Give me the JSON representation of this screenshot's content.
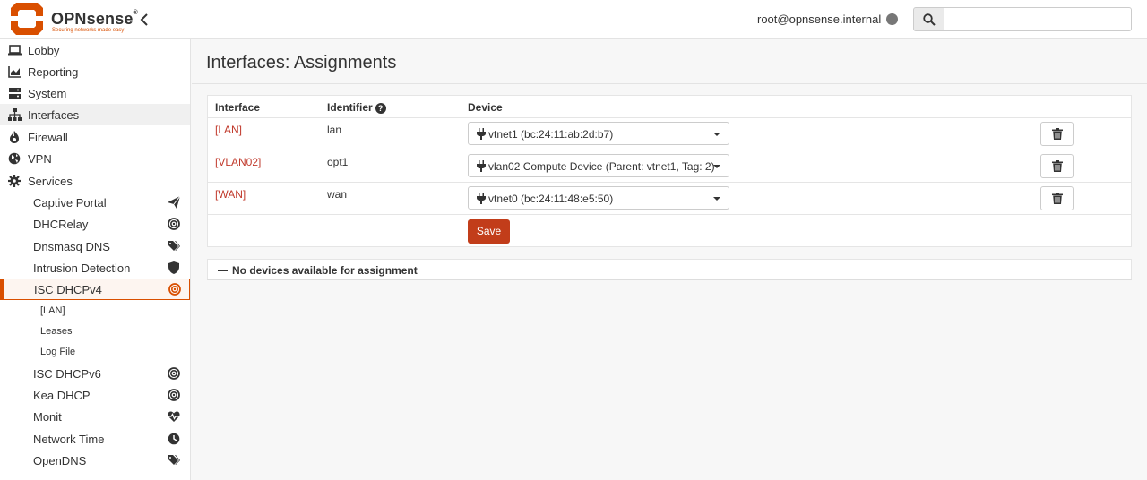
{
  "header": {
    "logo_name": "OPNsense",
    "logo_reg": "®",
    "tagline": "Securing networks made easy",
    "user": "root@opnsense.internal",
    "search_placeholder": "",
    "accent_color": "#d94f00"
  },
  "sidebar": {
    "items": [
      {
        "label": "Lobby",
        "icon": "laptop-icon"
      },
      {
        "label": "Reporting",
        "icon": "chart-icon"
      },
      {
        "label": "System",
        "icon": "server-icon"
      },
      {
        "label": "Interfaces",
        "icon": "sitemap-icon"
      },
      {
        "label": "Firewall",
        "icon": "fire-icon"
      },
      {
        "label": "VPN",
        "icon": "globe-icon"
      },
      {
        "label": "Services",
        "icon": "gear-icon"
      }
    ],
    "services": [
      {
        "label": "Captive Portal",
        "icon": "paper-plane-icon"
      },
      {
        "label": "DHCRelay",
        "icon": "bullseye-icon"
      },
      {
        "label": "Dnsmasq DNS",
        "icon": "tags-icon"
      },
      {
        "label": "Intrusion Detection",
        "icon": "shield-icon"
      },
      {
        "label": "ISC DHCPv4",
        "icon": "bullseye-icon"
      },
      {
        "label": "ISC DHCPv6",
        "icon": "bullseye-icon"
      },
      {
        "label": "Kea DHCP",
        "icon": "bullseye-icon"
      },
      {
        "label": "Monit",
        "icon": "heartbeat-icon"
      },
      {
        "label": "Network Time",
        "icon": "clock-icon"
      },
      {
        "label": "OpenDNS",
        "icon": "tags-icon"
      }
    ],
    "dhcpv4_sub": [
      {
        "label": "[LAN]"
      },
      {
        "label": "Leases"
      },
      {
        "label": "Log File"
      }
    ]
  },
  "main": {
    "title": "Interfaces: Assignments",
    "columns": {
      "interface": "Interface",
      "identifier": "Identifier",
      "device": "Device"
    },
    "rows": [
      {
        "interface": "[LAN]",
        "identifier": "lan",
        "device": "vtnet1 (bc:24:11:ab:2d:b7)"
      },
      {
        "interface": "[VLAN02]",
        "identifier": "opt1",
        "device": "vlan02 Compute Device (Parent: vtnet1, Tag: 2)"
      },
      {
        "interface": "[WAN]",
        "identifier": "wan",
        "device": "vtnet0 (bc:24:11:48:e5:50)"
      }
    ],
    "save_label": "Save",
    "no_devices": "No devices available for assignment"
  }
}
